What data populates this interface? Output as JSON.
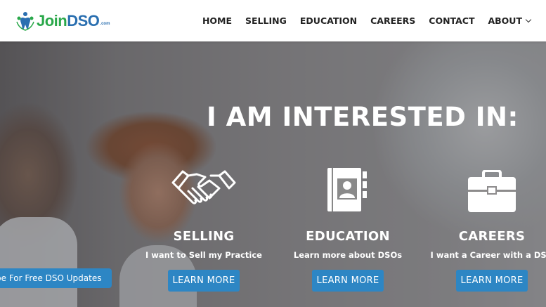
{
  "brand": {
    "logo_main": "Join",
    "logo_accent": "DSO",
    "logo_suffix": ".com"
  },
  "nav": {
    "items": [
      {
        "label": "HOME"
      },
      {
        "label": "SELLING"
      },
      {
        "label": "EDUCATION"
      },
      {
        "label": "CAREERS"
      },
      {
        "label": "CONTACT"
      },
      {
        "label": "ABOUT"
      }
    ]
  },
  "hero": {
    "headline": "I AM INTERESTED IN:",
    "cards": [
      {
        "icon": "handshake-icon",
        "title": "SELLING",
        "subtitle": "I want to Sell my Practice",
        "button": "LEARN MORE"
      },
      {
        "icon": "contact-book-icon",
        "title": "EDUCATION",
        "subtitle": "Learn more about DSOs",
        "button": "LEARN MORE"
      },
      {
        "icon": "briefcase-icon",
        "title": "CAREERS",
        "subtitle": "I want a Career with a DSO",
        "button": "LEARN MORE"
      }
    ],
    "subscribe_label": "be For Free DSO Updates"
  },
  "colors": {
    "accent": "#2d86c4",
    "logo_green": "#2aa84a",
    "logo_blue": "#2a6fb0"
  }
}
